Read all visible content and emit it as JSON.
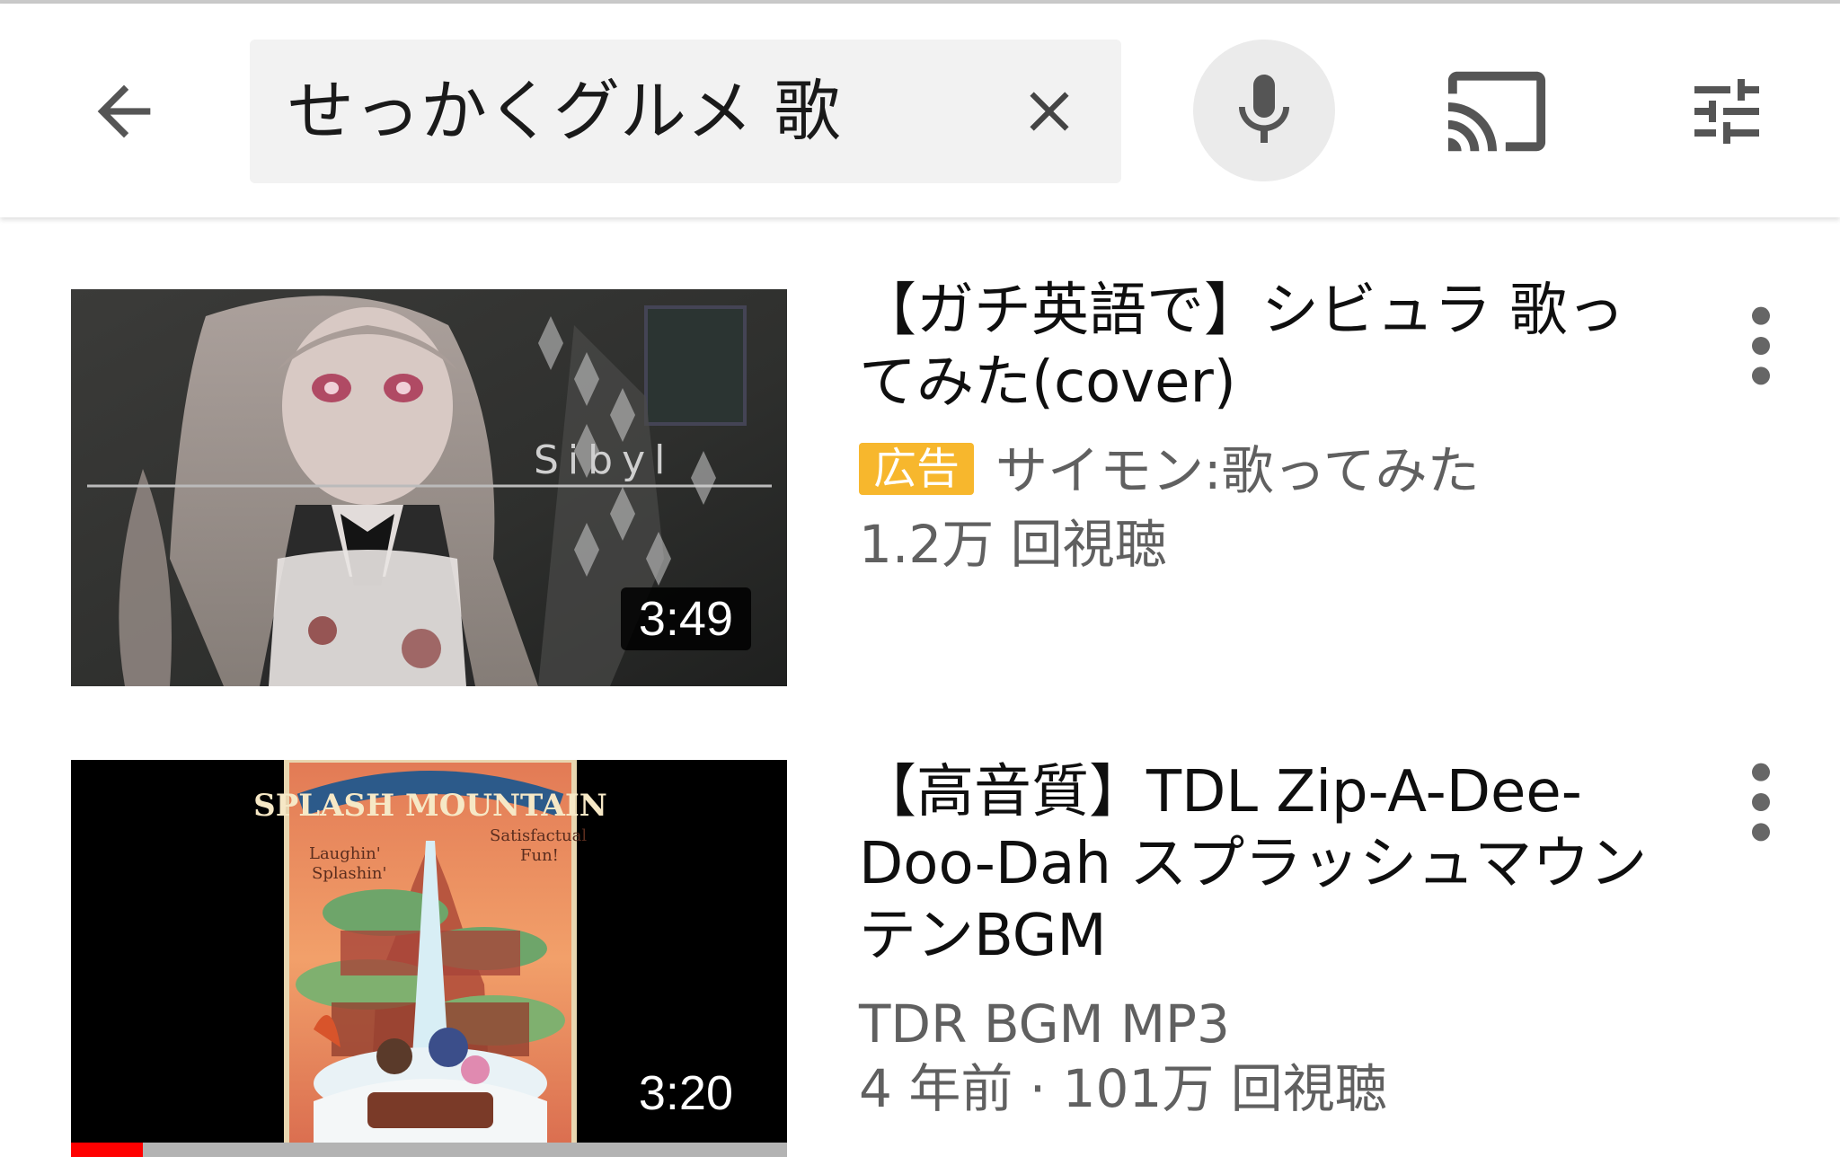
{
  "search": {
    "query": "せっかくグルメ 歌"
  },
  "icons": {
    "back": "arrow-left-icon",
    "clear": "close-icon",
    "mic": "microphone-icon",
    "cast": "cast-icon",
    "filter": "filter-sliders-icon",
    "more": "more-vertical-icon"
  },
  "colors": {
    "ad_badge": "#f7b72d",
    "progress": "#ff0000",
    "meta_text": "#606060"
  },
  "videos": [
    {
      "title": "【ガチ英語で】シビュラ 歌ってみた(cover)",
      "badge": "広告",
      "channel": "サイモン:歌ってみた",
      "stats": "1.2万 回視聴",
      "duration": "3:49",
      "thumb_text": "Sibyl"
    },
    {
      "title": "【高音質】TDL Zip-A-Dee-Doo-Dah スプラッシュマウンテンBGM",
      "channel": "TDR BGM MP3",
      "stats": "4 年前 · 101万 回視聴",
      "duration": "3:20",
      "watched_fraction": 0.1,
      "thumb_text": "SPLASH MOUNTAIN"
    }
  ]
}
